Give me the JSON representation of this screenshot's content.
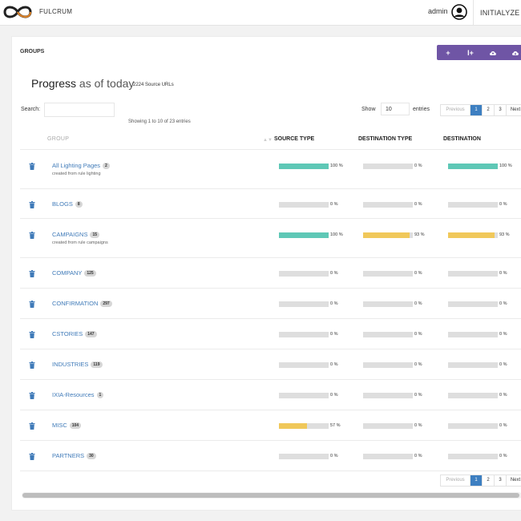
{
  "topbar": {
    "brand": "FULCRUM",
    "user": "admin",
    "initialize": "INITIALYZE"
  },
  "panel": {
    "title": "GROUPS",
    "toolbar": [
      {
        "label": "+",
        "icon": "plus-icon"
      },
      {
        "label": "I+",
        "icon": "add-row-icon"
      },
      {
        "label": "",
        "icon": "cloud-upload-icon"
      },
      {
        "label": "",
        "icon": "cloud-download-icon"
      }
    ],
    "headline_main": "Progress",
    "headline_sub": " as of today",
    "source_count": "2224 Source URLs"
  },
  "controls": {
    "search_label": "Search:",
    "search_value": "",
    "showing": "Showing 1 to 10 of 23 entries",
    "show_label": "Show",
    "show_value": "10",
    "entries_label": "entries"
  },
  "pagination": {
    "previous": "Previous",
    "pages": [
      "1",
      "2",
      "3"
    ],
    "active": "1",
    "next": "Next"
  },
  "table": {
    "columns": [
      "GROUP",
      "SOURCE TYPE",
      "DESTINATION TYPE",
      "DESTINATION"
    ],
    "rows": [
      {
        "name": "All Lighting Pages",
        "count": "2",
        "sub": "created from rule lighting",
        "source": 100,
        "dest_type": 0,
        "dest": 100
      },
      {
        "name": "BLOGS",
        "count": "8",
        "sub": "",
        "source": 0,
        "dest_type": 0,
        "dest": 0
      },
      {
        "name": "CAMPAIGNS",
        "count": "15",
        "sub": "created from rule campaigns",
        "source": 100,
        "dest_type": 93,
        "dest": 93
      },
      {
        "name": "COMPANY",
        "count": "125",
        "sub": "",
        "source": 0,
        "dest_type": 0,
        "dest": 0
      },
      {
        "name": "CONFIRMATION",
        "count": "297",
        "sub": "",
        "source": 0,
        "dest_type": 0,
        "dest": 0
      },
      {
        "name": "CSTORIES",
        "count": "147",
        "sub": "",
        "source": 0,
        "dest_type": 0,
        "dest": 0
      },
      {
        "name": "INDUSTRIES",
        "count": "119",
        "sub": "",
        "source": 0,
        "dest_type": 0,
        "dest": 0
      },
      {
        "name": "IXIA-Resources",
        "count": "1",
        "sub": "",
        "source": 0,
        "dest_type": 0,
        "dest": 0
      },
      {
        "name": "MISC",
        "count": "104",
        "sub": "",
        "source": 57,
        "dest_type": 0,
        "dest": 0
      },
      {
        "name": "PARTNERS",
        "count": "30",
        "sub": "",
        "source": 0,
        "dest_type": 0,
        "dest": 0
      }
    ]
  },
  "colors": {
    "complete": "#5ec8b6",
    "partial": "#f0c85a",
    "track": "#dedede",
    "link": "#3f7ab8",
    "accent": "#6f55a5",
    "active_page": "#3d7fc1"
  }
}
